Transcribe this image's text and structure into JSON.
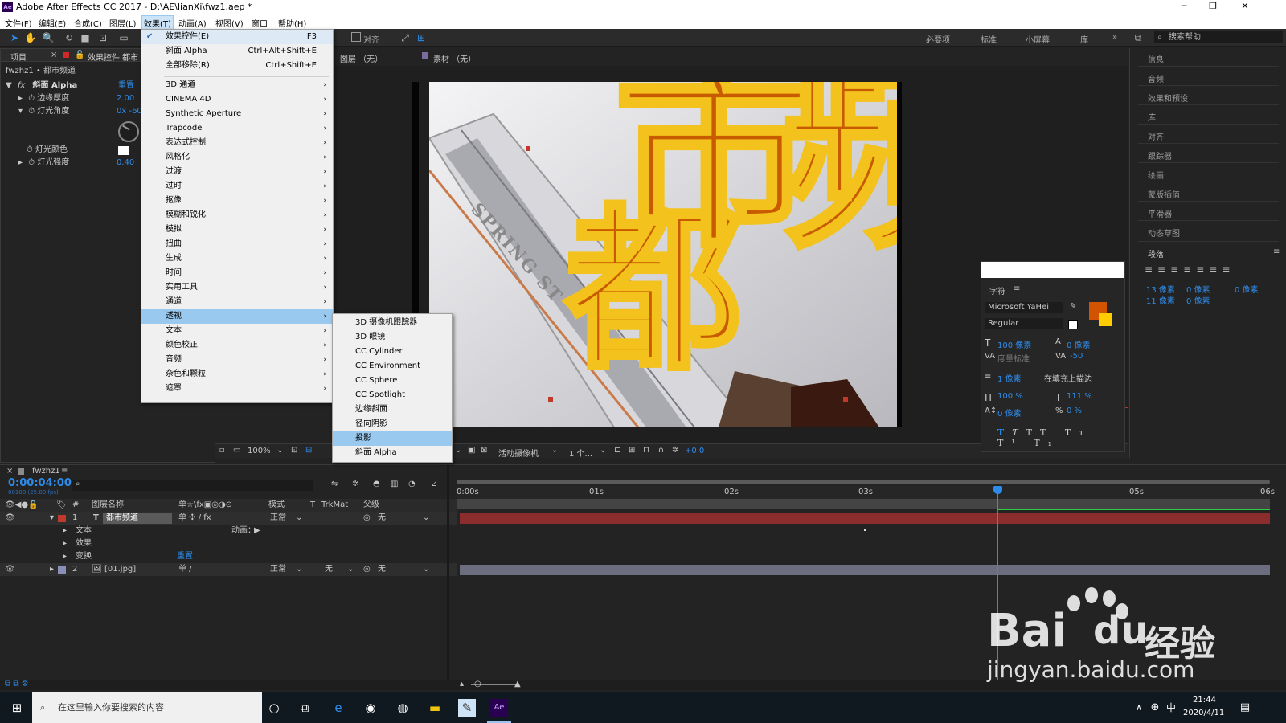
{
  "titlebar": {
    "title": "Adobe After Effects CC 2017 - D:\\AE\\lianXi\\fwz1.aep *",
    "app_icon": "Ae"
  },
  "menubar": [
    "文件(F)",
    "编辑(E)",
    "合成(C)",
    "图层(L)",
    "效果(T)",
    "动画(A)",
    "视图(V)",
    "窗口",
    "帮助(H)"
  ],
  "toolbar": {
    "align_label": "对齐",
    "workspaces": [
      "必要项",
      "标准",
      "小屏幕",
      "库"
    ],
    "help_search": "搜索帮助"
  },
  "left_panel": {
    "tab_project": "项目",
    "tab_effects": "效果控件 都市",
    "breadcrumb": "fwzhz1 • 都市频道",
    "effect_name": "斜面 Alpha",
    "reset": "重置",
    "params": [
      {
        "name": "边缘厚度",
        "value": "2.00"
      },
      {
        "name": "灯光角度",
        "value": "0x -60."
      },
      {
        "name": "灯光颜色",
        "value": ""
      },
      {
        "name": "灯光强度",
        "value": "0.40"
      }
    ]
  },
  "effect_menu": {
    "top_items": [
      {
        "label": "效果控件(E)",
        "shortcut": "F3",
        "checked": true
      },
      {
        "label": "斜面 Alpha",
        "shortcut": "Ctrl+Alt+Shift+E"
      },
      {
        "label": "全部移除(R)",
        "shortcut": "Ctrl+Shift+E"
      }
    ],
    "categories": [
      "3D 通道",
      "CINEMA 4D",
      "Synthetic Aperture",
      "Trapcode",
      "表达式控制",
      "风格化",
      "过渡",
      "过时",
      "抠像",
      "模糊和锐化",
      "模拟",
      "扭曲",
      "生成",
      "时间",
      "实用工具",
      "通道",
      "透视",
      "文本",
      "颜色校正",
      "音频",
      "杂色和颗粒",
      "遮罩"
    ],
    "highlighted": "透视"
  },
  "perspective_submenu": {
    "items": [
      "3D 摄像机跟踪器",
      "3D 眼镜",
      "CC Cylinder",
      "CC Environment",
      "CC Sphere",
      "CC Spotlight",
      "边缘斜面",
      "径向阴影",
      "投影",
      "斜面 Alpha"
    ],
    "highlighted": "投影"
  },
  "viewer": {
    "layer_label": "图层 （无）",
    "footage_label": "素材 （无）",
    "art_text_1": "都",
    "art_text_2": "市频",
    "street_text": "SPRING ST",
    "bottom_bar": {
      "zoom": "100%",
      "camera": "活动摄像机",
      "views": "1 个...",
      "exposure": "+0.0"
    }
  },
  "right_panel": {
    "items": [
      "信息",
      "音频",
      "效果和预设",
      "库",
      "对齐",
      "跟踪器",
      "绘画",
      "蒙版插值",
      "平滑器",
      "动态草图"
    ],
    "paragraph_title": "段落",
    "paragraph_values": [
      "13 像素",
      "0 像素",
      "0 像素",
      "11 像素",
      "0 像素"
    ]
  },
  "character_panel": {
    "title": "字符",
    "font": "Microsoft YaHei",
    "style": "Regular",
    "size": "100 像素",
    "leading": "0 像素",
    "kerning": "度量标准",
    "tracking": "-50",
    "stroke_width": "1 像素",
    "stroke_option": "在填充上描边",
    "vscale": "100 %",
    "hscale": "111 %",
    "baseline": "0 像素",
    "tsume": "0 %",
    "fill_color": "#d35400",
    "stroke_color": "#ffcc00"
  },
  "timeline": {
    "comp_tab": "fwzhz1",
    "timecode": "0:00:04:00",
    "timecode_sub": "00100 (25.00 fps)",
    "headers": {
      "name": "图层名称",
      "mode": "模式",
      "t": "T",
      "trkmat": "TrkMat",
      "parent": "父级"
    },
    "time_ruler": [
      "0:00s",
      "01s",
      "02s",
      "03s",
      "05s",
      "06s"
    ],
    "layers": [
      {
        "num": "1",
        "type": "T",
        "name": "都市频道",
        "mode": "正常",
        "parent": "无",
        "color": "#c0392b"
      },
      {
        "num": "2",
        "type": "img",
        "name": "[01.jpg]",
        "mode": "正常",
        "trkmat": "无",
        "parent": "无",
        "color": "#8a8fb8"
      }
    ],
    "sublayers": [
      {
        "name": "文本",
        "extra": "动画："
      },
      {
        "name": "效果",
        "extra": ""
      },
      {
        "name": "变换",
        "extra": "重置"
      }
    ]
  },
  "taskbar": {
    "search_placeholder": "在这里输入你要搜索的内容",
    "ime": "中",
    "time": "21:44",
    "date": "2020/4/11"
  },
  "watermark": {
    "brand": "Bai",
    "brand_cn": "经验",
    "url": "jingyan.baidu.com"
  }
}
